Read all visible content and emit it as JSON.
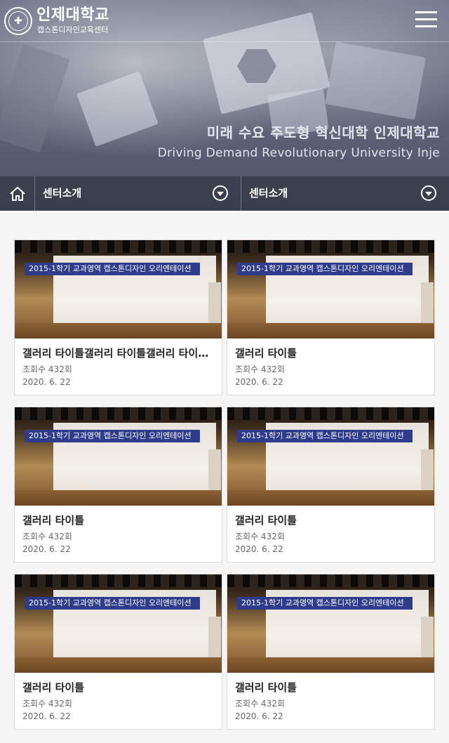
{
  "header": {
    "logo_mark_glyph": "✚",
    "title": "인제대학교",
    "subtitle": "캡스톤디자인교육센터",
    "menu_icon": "hamburger-menu-icon"
  },
  "hero": {
    "slogan_ko": "미래 수요 주도형 혁신대학 인제대학교",
    "slogan_en": "Driving Demand Revolutionary University Inje"
  },
  "nav": {
    "home_icon": "home-icon",
    "select_1": {
      "label": "센터소개"
    },
    "select_2": {
      "label": "센터소개"
    },
    "dropdown_icon": "chevron-down-circle-icon"
  },
  "gallery": {
    "thumbnail_banner_text": "2015-1학기 교과영역 캡스톤디자인 오리엔테이션",
    "items": [
      {
        "title": "갤러리 타이틀갤러리 타이틀갤러리 타이틀갤러리 타이틀",
        "views": "조회수 432회",
        "date": "2020. 6. 22"
      },
      {
        "title": "갤러리 타이틀",
        "views": "조회수 432회",
        "date": "2020. 6. 22"
      },
      {
        "title": "갤러리 타이틀",
        "views": "조회수 432회",
        "date": "2020. 6. 22"
      },
      {
        "title": "갤러리 타이틀",
        "views": "조회수 432회",
        "date": "2020. 6. 22"
      },
      {
        "title": "갤러리 타이틀",
        "views": "조회수 432회",
        "date": "2020. 6. 22"
      },
      {
        "title": "갤러리 타이틀",
        "views": "조회수 432회",
        "date": "2020. 6. 22"
      }
    ]
  }
}
